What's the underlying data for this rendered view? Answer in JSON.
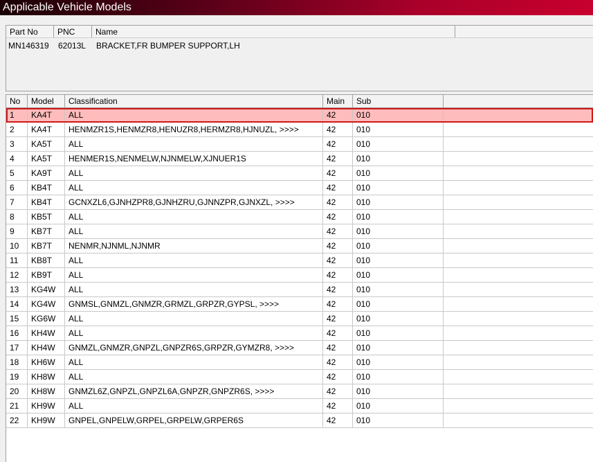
{
  "window": {
    "title": "Applicable Vehicle Models"
  },
  "part_table": {
    "headers": [
      "Part No",
      "PNC",
      "Name"
    ],
    "row": {
      "part_no": "MN146319",
      "pnc": "62013L",
      "name": "BRACKET,FR BUMPER SUPPORT,LH"
    }
  },
  "models_table": {
    "headers": [
      "No",
      "Model",
      "Classification",
      "Main",
      "Sub"
    ],
    "selected_row": 1,
    "rows": [
      [
        "1",
        "KA4T",
        "ALL",
        "42",
        "010"
      ],
      [
        "2",
        "KA4T",
        "HENMZR1S,HENMZR8,HENUZR8,HERMZR8,HJNUZL,   >>>>",
        "42",
        "010"
      ],
      [
        "3",
        "KA5T",
        "ALL",
        "42",
        "010"
      ],
      [
        "4",
        "KA5T",
        "HENMER1S,NENMELW,NJNMELW,XJNUER1S",
        "42",
        "010"
      ],
      [
        "5",
        "KA9T",
        "ALL",
        "42",
        "010"
      ],
      [
        "6",
        "KB4T",
        "ALL",
        "42",
        "010"
      ],
      [
        "7",
        "KB4T",
        "GCNXZL6,GJNHZPR8,GJNHZRU,GJNNZPR,GJNXZL,   >>>>",
        "42",
        "010"
      ],
      [
        "8",
        "KB5T",
        "ALL",
        "42",
        "010"
      ],
      [
        "9",
        "KB7T",
        "ALL",
        "42",
        "010"
      ],
      [
        "10",
        "KB7T",
        "NENMR,NJNML,NJNMR",
        "42",
        "010"
      ],
      [
        "11",
        "KB8T",
        "ALL",
        "42",
        "010"
      ],
      [
        "12",
        "KB9T",
        "ALL",
        "42",
        "010"
      ],
      [
        "13",
        "KG4W",
        "ALL",
        "42",
        "010"
      ],
      [
        "14",
        "KG4W",
        "GNMSL,GNMZL,GNMZR,GRMZL,GRPZR,GYPSL,   >>>>",
        "42",
        "010"
      ],
      [
        "15",
        "KG6W",
        "ALL",
        "42",
        "010"
      ],
      [
        "16",
        "KH4W",
        "ALL",
        "42",
        "010"
      ],
      [
        "17",
        "KH4W",
        "GNMZL,GNMZR,GNPZL,GNPZR6S,GRPZR,GYMZR8,   >>>>",
        "42",
        "010"
      ],
      [
        "18",
        "KH6W",
        "ALL",
        "42",
        "010"
      ],
      [
        "19",
        "KH8W",
        "ALL",
        "42",
        "010"
      ],
      [
        "20",
        "KH8W",
        "GNMZL6Z,GNPZL,GNPZL6A,GNPZR,GNPZR6S,   >>>>",
        "42",
        "010"
      ],
      [
        "21",
        "KH9W",
        "ALL",
        "42",
        "010"
      ],
      [
        "22",
        "KH9W",
        "GNPEL,GNPELW,GRPEL,GRPELW,GRPER6S",
        "42",
        "010"
      ]
    ]
  }
}
